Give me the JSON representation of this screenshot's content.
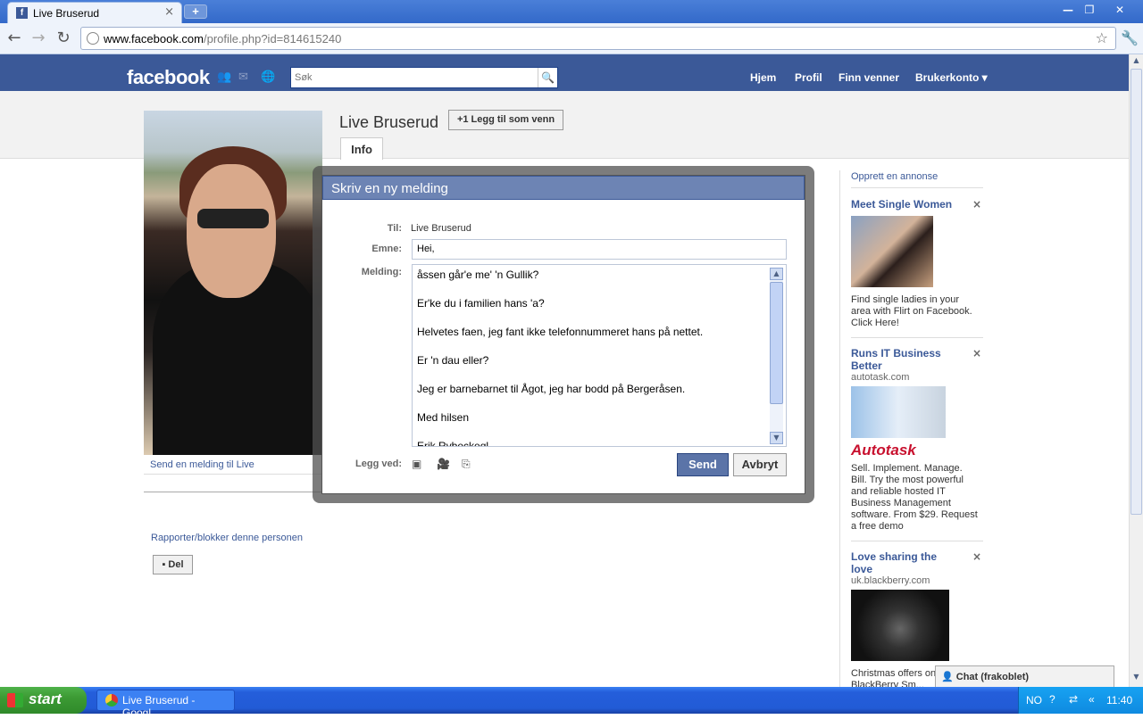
{
  "browser": {
    "tab_title": "Live Bruserud",
    "tab_favicon": "f",
    "url_host": "www.facebook.com",
    "url_path": "/profile.php?id=814615240"
  },
  "facebook": {
    "logo": "facebook",
    "search_placeholder": "Søk",
    "nav": [
      "Hjem",
      "Profil",
      "Finn venner",
      "Brukerkonto ▾"
    ]
  },
  "profile": {
    "name": "Live Bruserud",
    "add_friend": "+1 Legg til som venn",
    "tab_info": "Info",
    "send_message_link": "Send en melding til Live",
    "report_link": "Rapporter/blokker denne personen",
    "share_button": "Del"
  },
  "dialog": {
    "title": "Skriv en ny melding",
    "to_label": "Til:",
    "to_value": "Live Bruserud",
    "subject_label": "Emne:",
    "subject_value": "Hei,",
    "message_label": "Melding:",
    "message_lines": [
      "åssen går'e me' 'n Gullik?",
      "",
      "Er'ke du i familien hans 'a?",
      "",
      "Helvetes faen, jeg fant ikke telefonnummeret hans på nettet.",
      "",
      "Er 'n dau eller?",
      "",
      "Jeg er barnebarnet til Ågot, jeg har bodd på Bergeråsen.",
      "",
      "Med hilsen",
      "",
      "Erik Rybeckeql"
    ],
    "attach_label": "Legg ved:",
    "send": "Send",
    "cancel": "Avbryt"
  },
  "sidebar": {
    "create_ad": "Opprett en annonse",
    "ads": [
      {
        "title": "Meet Single Women",
        "domain": "",
        "text": "Find single ladies in your area with Flirt on Facebook. Click Here!"
      },
      {
        "title": "Runs IT Business Better",
        "domain": "autotask.com",
        "brand": "Autotask",
        "text": "Sell. Implement. Manage. Bill. Try the most powerful and reliable hosted IT Business Management software. From $29. Request a free demo"
      },
      {
        "title": "Love sharing the love",
        "domain": "uk.blackberry.com",
        "text": "Christmas offers on BlackBerry Sm..."
      }
    ]
  },
  "chat": {
    "label": "Chat (frakoblet)"
  },
  "taskbar": {
    "start": "start",
    "item": "Live Bruserud - Googl...",
    "lang": "NO",
    "time": "11:40"
  }
}
